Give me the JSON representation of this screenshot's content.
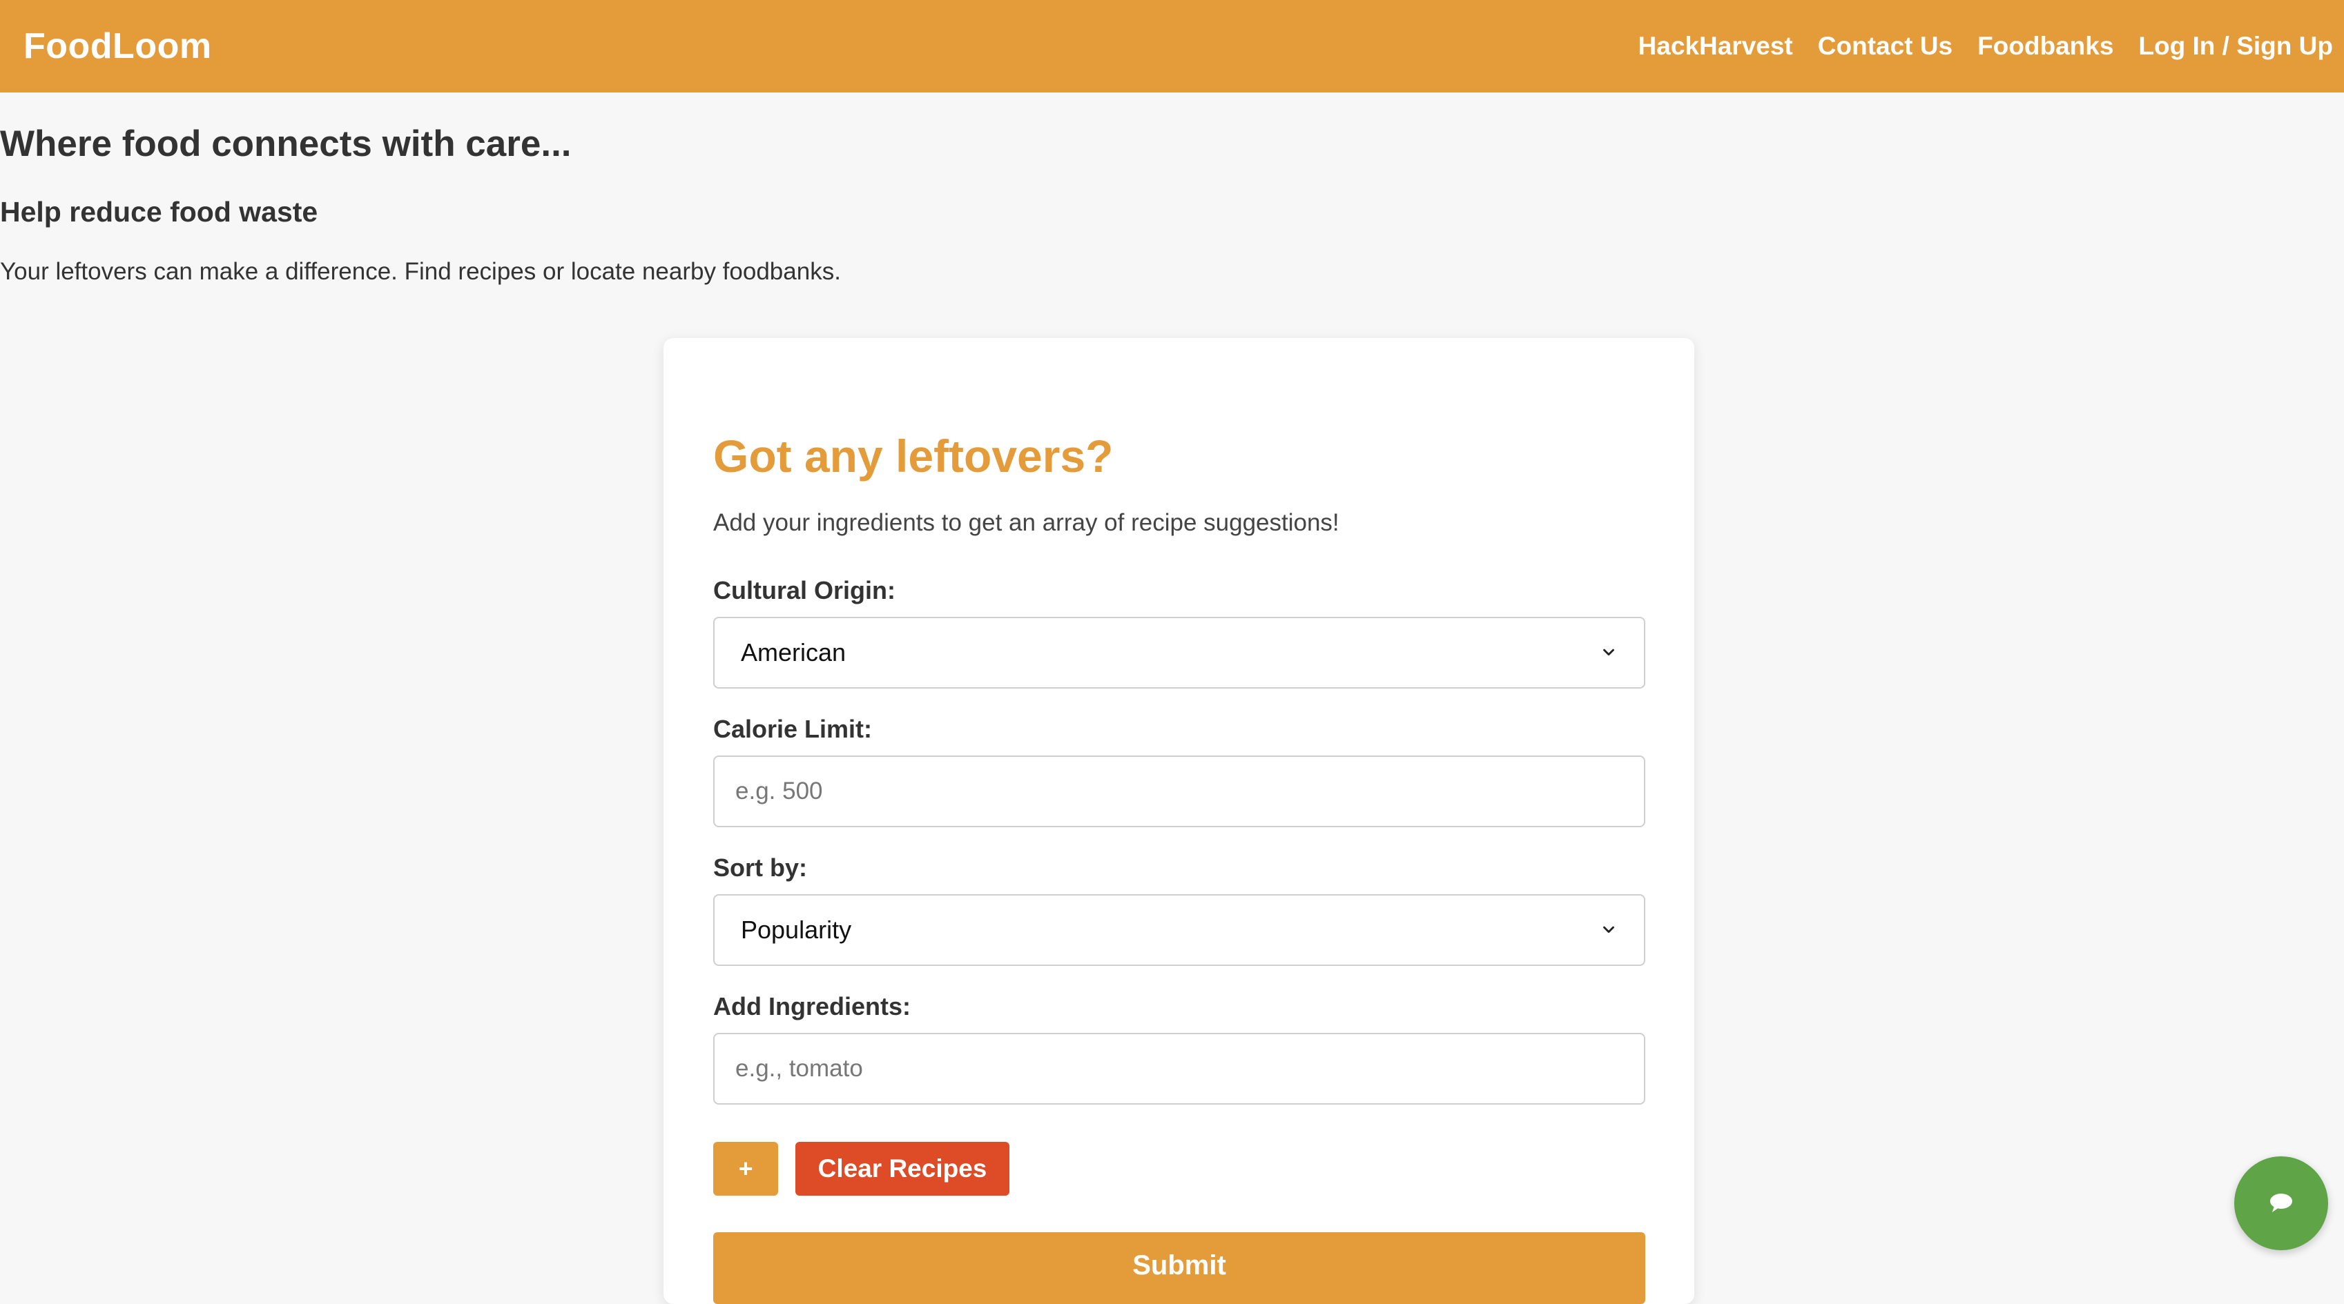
{
  "header": {
    "brand": "FoodLoom",
    "nav": [
      "HackHarvest",
      "Contact Us",
      "Foodbanks",
      "Log In / Sign Up"
    ],
    "background_color": "#e49b3a"
  },
  "hero": {
    "title": "Where food connects with care...",
    "subtitle": "Help reduce food waste",
    "description": "Your leftovers can make a difference. Find recipes or locate nearby foodbanks."
  },
  "form": {
    "title": "Got any leftovers?",
    "subtitle": "Add your ingredients to get an array of recipe suggestions!",
    "cultural_origin_label": "Cultural Origin:",
    "cultural_origin_value": "American",
    "calorie_label": "Calorie Limit:",
    "calorie_placeholder": "e.g. 500",
    "sort_label": "Sort by:",
    "sort_value": "Popularity",
    "ingredients_label": "Add Ingredients:",
    "ingredients_placeholder": "e.g., tomato",
    "add_button": "+",
    "clear_button": "Clear Recipes",
    "submit_button": "Submit",
    "accent_color": "#e49b3a",
    "clear_color": "#dd4b27"
  },
  "chat": {
    "icon": "chat-bubble-icon",
    "color": "#5fa447"
  }
}
